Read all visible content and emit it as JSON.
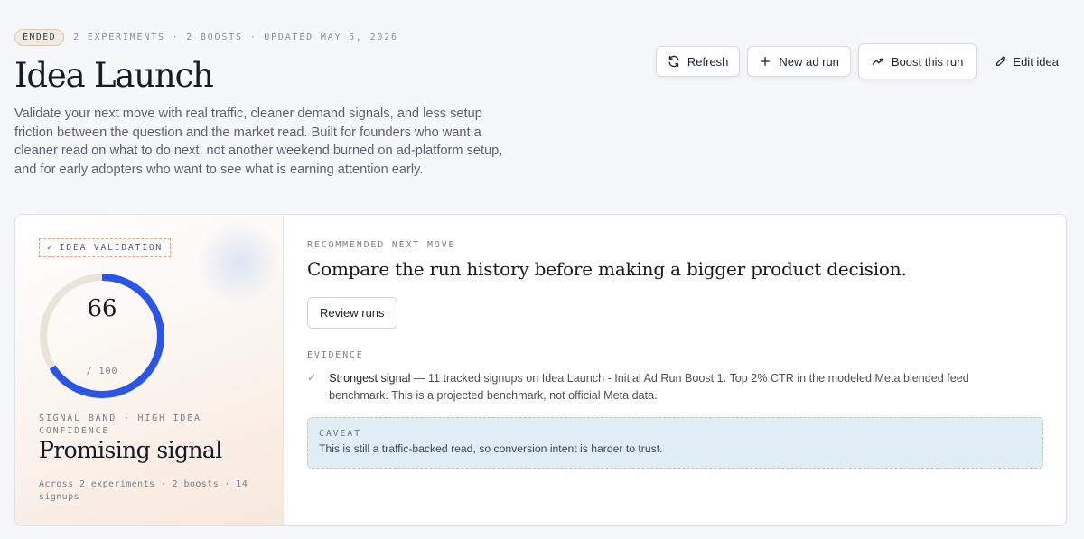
{
  "header": {
    "status": "ENDED",
    "meta": "2 EXPERIMENTS · 2 BOOSTS · UPDATED MAY 6, 2026",
    "title": "Idea Launch",
    "description": "Validate your next move with real traffic, cleaner demand signals, and less setup friction between the question and the market read.  Built for founders who want a cleaner read on what to do next, not another weekend burned on ad-platform setup, and for early adopters who want to see what is earning attention early."
  },
  "actions": {
    "refresh": "Refresh",
    "new_ad_run": "New ad run",
    "boost": "Boost this run",
    "edit": "Edit idea"
  },
  "score_panel": {
    "tag": "IDEA VALIDATION",
    "score": "66",
    "score_value": 66,
    "score_max": "/ 100",
    "band_label": "SIGNAL BAND · HIGH IDEA CONFIDENCE",
    "band_title": "Promising signal",
    "footnote": "Across 2 experiments · 2 boosts · 14 signups",
    "colors": {
      "gauge_fill": "#2b55e6",
      "gauge_track": "#eae3da"
    }
  },
  "recommendation": {
    "label": "RECOMMENDED NEXT MOVE",
    "title": "Compare the run history before making a bigger product decision.",
    "button": "Review runs"
  },
  "evidence": {
    "label": "EVIDENCE",
    "items": [
      {
        "strong": "Strongest signal",
        "text": " — 11 tracked signups on Idea Launch - Initial Ad Run Boost 1. Top 2% CTR in the modeled Meta blended feed benchmark. This is a projected benchmark, not official Meta data."
      }
    ]
  },
  "caveat": {
    "label": "CAVEAT",
    "text": "This is still a traffic-backed read, so conversion intent is harder to trust."
  },
  "icons": [
    "refresh-icon",
    "plus-icon",
    "trend-up-icon",
    "pencil-icon",
    "check-icon"
  ]
}
